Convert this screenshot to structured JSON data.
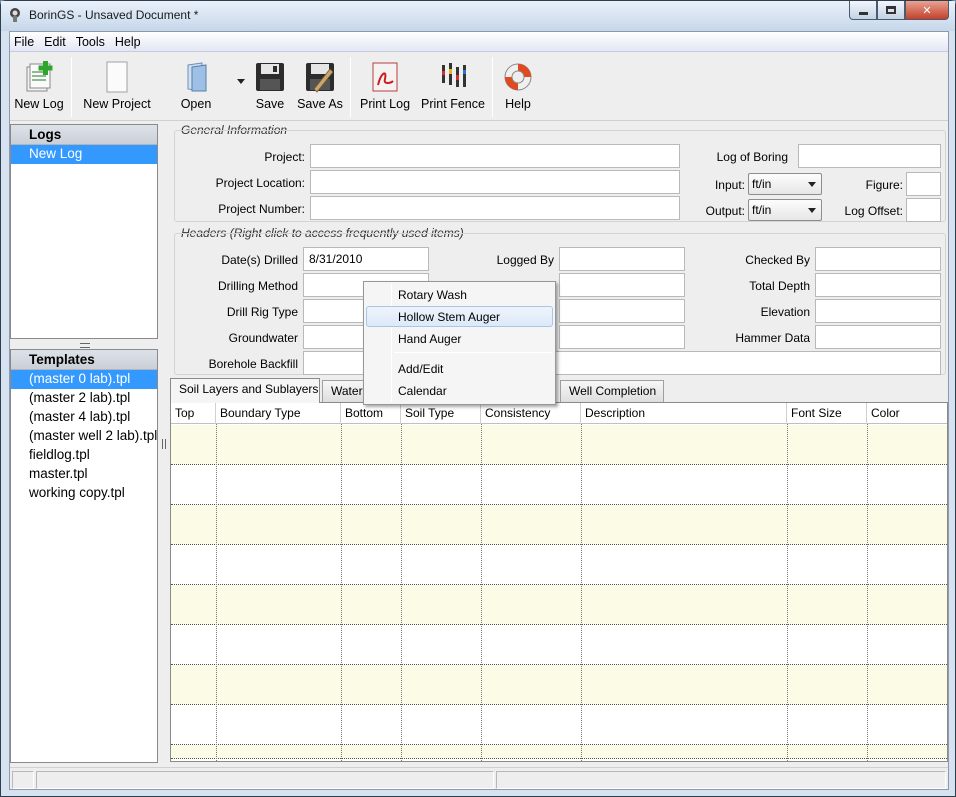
{
  "window": {
    "title": "BorinGS - Unsaved Document *"
  },
  "menubar": {
    "items": [
      "File",
      "Edit",
      "Tools",
      "Help"
    ]
  },
  "toolbar": {
    "new_log": "New Log",
    "new_project": "New Project",
    "open": "Open",
    "save": "Save",
    "save_as": "Save As",
    "print_log": "Print Log",
    "print_fence": "Print Fence",
    "help": "Help"
  },
  "logs_panel": {
    "title": "Logs",
    "items": [
      "New Log"
    ]
  },
  "templates_panel": {
    "title": "Templates",
    "items": [
      "(master 0 lab).tpl",
      "(master 2 lab).tpl",
      "(master 4 lab).tpl",
      "(master well 2 lab).tpl",
      "fieldlog.tpl",
      "master.tpl",
      "working copy.tpl"
    ]
  },
  "general_info": {
    "title": "General Information",
    "project_label": "Project:",
    "project_location_label": "Project Location:",
    "project_number_label": "Project Number:",
    "log_of_boring_label": "Log of Boring",
    "input_label": "Input:",
    "input_value": "ft/in",
    "output_label": "Output:",
    "output_value": "ft/in",
    "figure_label": "Figure:",
    "log_offset_label": "Log Offset:"
  },
  "headers": {
    "title": "Headers (Right click to access frequently used items)",
    "dates_drilled_label": "Date(s) Drilled",
    "dates_drilled_value": "8/31/2010",
    "drilling_method_label": "Drilling Method",
    "drill_rig_type_label": "Drill Rig Type",
    "groundwater_label": "Groundwater",
    "borehole_backfill_label": "Borehole Backfill",
    "logged_by_label": "Logged By",
    "checked_by_label": "Checked By",
    "total_depth_label": "Total Depth",
    "elevation_label": "Elevation",
    "hammer_data_label": "Hammer Data"
  },
  "context_menu": {
    "items": [
      "Rotary Wash",
      "Hollow Stem Auger",
      "Hand Auger",
      "Add/Edit",
      "Calendar"
    ],
    "highlighted": "Hollow Stem Auger"
  },
  "tabs": {
    "soil_layers": "Soil Layers and Sublayers",
    "water": "Water",
    "well_completion": "Well Completion"
  },
  "table": {
    "columns": [
      "Top",
      "Boundary Type",
      "Bottom",
      "Soil Type",
      "Consistency",
      "Description",
      "Font Size",
      "Color"
    ]
  }
}
